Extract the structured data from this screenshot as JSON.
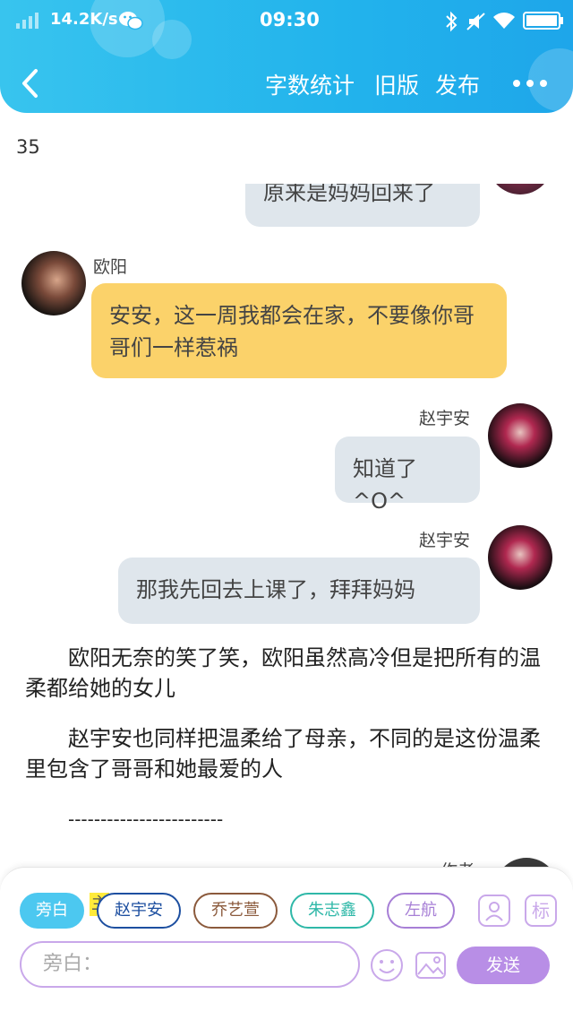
{
  "status_bar": {
    "network_speed": "14.2K/s",
    "time": "09:30"
  },
  "nav": {
    "word_count_label": "字数统计",
    "old_version_label": "旧版",
    "publish_label": "发布"
  },
  "word_count": "35",
  "messages": [
    {
      "text": "原来是妈妈回来了"
    },
    {
      "sender": "欧阳",
      "text": "安安，这一周我都会在家，不要像你哥哥们一样惹祸",
      "color": "#fbd26a"
    },
    {
      "sender": "赵宇安",
      "text": "知道了^O^"
    },
    {
      "sender": "赵宇安",
      "text": "那我先回去上课了，拜拜妈妈"
    }
  ],
  "narration": [
    "欧阳无奈的笑了笑，欧阳虽然高冷但是把所有的温柔都给她的女儿",
    "赵宇安也同样把温柔给了母亲，不同的是这份温柔里包含了哥哥和她最爱的人",
    "------------------------"
  ],
  "partial_sender": "作者",
  "roles": {
    "mark": "主",
    "items": [
      {
        "label": "旁白",
        "color": "#4cc8f0"
      },
      {
        "label": "赵宇安",
        "color": "#1d4fa0"
      },
      {
        "label": "乔艺萱",
        "color": "#8b5a3c"
      },
      {
        "label": "朱志鑫",
        "color": "#2fb8a8"
      },
      {
        "label": "左航",
        "color": "#a77fd6"
      }
    ]
  },
  "tag_icon_label": "标",
  "input": {
    "placeholder": "旁白："
  },
  "send_label": "发送"
}
